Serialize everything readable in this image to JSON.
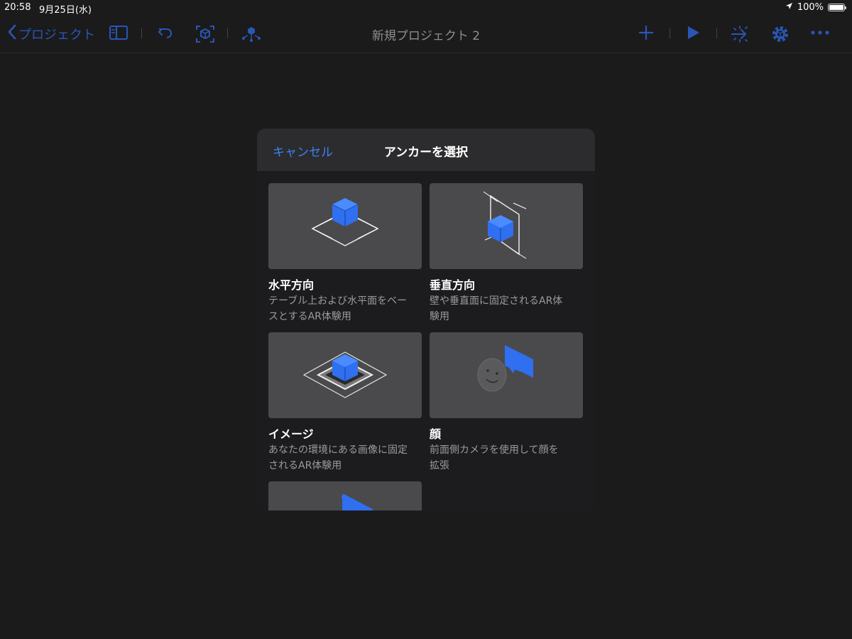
{
  "status": {
    "time": "20:58",
    "date": "9月25日(水)",
    "battery": "100%",
    "battery_level": 1.0
  },
  "toolbar": {
    "back_label": "プロジェクト",
    "title": "新規プロジェクト 2",
    "icons": [
      "chevron-left-icon",
      "sidebar-icon",
      "undo-icon",
      "ar-cube-icon",
      "scene-icon",
      "plus-icon",
      "play-icon",
      "behaviors-icon",
      "settings-gear-icon",
      "more-icon"
    ]
  },
  "modal": {
    "cancel_label": "キャンセル",
    "title": "アンカーを選択",
    "items": [
      {
        "name": "水平方向",
        "desc_line1": "テーブル上および水平面をベー",
        "desc_line2": "スとするAR体験用"
      },
      {
        "name": "垂直方向",
        "desc_line1": "壁や垂直面に固定されるAR体",
        "desc_line2": "験用"
      },
      {
        "name": "イメージ",
        "desc_line1": "あなたの環境にある画像に固定",
        "desc_line2": "されるAR体験用"
      },
      {
        "name": "顔",
        "desc_line1": "前面側カメラを使用して顔を",
        "desc_line2": "拡張"
      }
    ]
  },
  "colors": {
    "accent": "#3a82f7",
    "toolbar_icon": "#2a56b5",
    "background": "#1b1b1c",
    "card": "#4a4a4c",
    "cube": "#2f6ff0"
  }
}
